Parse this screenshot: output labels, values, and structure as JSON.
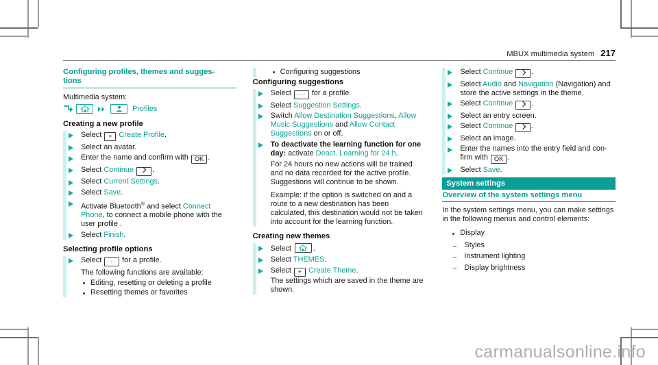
{
  "header": {
    "title": "MBUX multimedia system",
    "page_number": "217"
  },
  "colors": {
    "accent": "#0a9e96",
    "rail": "#c9f1f0",
    "text": "#1a1a1a",
    "band_text": "#ffffff"
  },
  "watermark": "carmanualsonline.info",
  "icons": {
    "arrow": "arrow-right-icon",
    "home": "home-icon",
    "profile": "profile-person-icon",
    "double_chevron": "double-chevron-right-icon",
    "plus_key": "plus-key-icon",
    "ok_key": "ok-key-icon",
    "dots_key": "ellipsis-key-icon",
    "chevron_key": "chevron-right-key-icon"
  },
  "column1": {
    "section_title": "Configuring profiles, themes and sugges-\ntions",
    "intro_label": "Multimedia system:",
    "path": {
      "home_label": "",
      "profiles_label": "Profiles"
    },
    "sub1": "Creating a new profile",
    "steps1": [
      {
        "pre": "Select",
        "key": "+",
        "link": "Create Profile",
        "post": "."
      },
      {
        "pre": "Select an avatar.",
        "key": "",
        "link": "",
        "post": ""
      },
      {
        "pre": "Enter the name and confirm with",
        "key": "OK",
        "link": "",
        "post": "."
      },
      {
        "pre": "Select",
        "key": ">",
        "link": "Continue",
        "post": "."
      },
      {
        "pre": "Select",
        "key": "",
        "link": "Current Settings",
        "post": "."
      },
      {
        "pre": "Select",
        "key": "",
        "link": "Save",
        "post": "."
      }
    ],
    "step_bluetooth": {
      "t1": "Activate Bluetooth",
      "sup": "®",
      "t2": " and select ",
      "link": "Connect Phone",
      "t3": ", to connect a mobile phone with the user profile ."
    },
    "step_finish": {
      "pre": "Select",
      "link": "Finish",
      "post": "."
    },
    "sub2": "Selecting profile options",
    "step_options": {
      "pre": "Select",
      "key": "···",
      "post": "for a profile."
    },
    "options_intro": "The following functions are available:",
    "options_list": [
      "Editing, resetting or deleting a profile",
      "Resetting themes or favorites"
    ]
  },
  "column2": {
    "top_bullet": "Configuring suggestions",
    "sub1": "Configuring suggestions",
    "steps": [
      {
        "pre": "Select",
        "key": "···",
        "post": "for a profile."
      },
      {
        "pre": "Select",
        "link": "Suggestion Settings",
        "post": "."
      }
    ],
    "switch_step": {
      "t1": "Switch ",
      "l1": "Allow Destination Suggestions",
      "t2": ", ",
      "l2": "Allow Music Suggestions",
      "t3": " and ",
      "l3": "Allow Contact Suggestions",
      "t4": " on or off."
    },
    "deactivate_step": {
      "bold": "To deactivate the learning function for one day:",
      "t1": " activate ",
      "link": "Deact. Learning for 24 h",
      "t2": "."
    },
    "deactivate_para": "For 24 hours no new actions will be trained and no data recorded for the active profile. Suggestions will continue to be shown.",
    "example_para": "Example: if the option is switched on and a route to a new destination has been calculated, this destination would not be taken into account for the learning function.",
    "sub2": "Creating new themes",
    "theme_steps": [
      {
        "pre": "Select",
        "key": "home",
        "post": "."
      },
      {
        "pre": "Select",
        "link": "THEMES",
        "post": "."
      },
      {
        "pre": "Select",
        "key": "+",
        "link": "Create Theme",
        "post": "."
      }
    ],
    "theme_note": "The settings which are saved in the theme are shown."
  },
  "column3": {
    "steps": [
      {
        "pre": "Select",
        "link": "Continue",
        "key": ">",
        "post": "."
      }
    ],
    "audio_nav_step": {
      "t1": "Select ",
      "l1": "Audio",
      "t2": " and ",
      "l2": "Navigation",
      "t3": " (Navigation) and store the active settings in the theme."
    },
    "steps_rest": [
      {
        "pre": "Select",
        "link": "Continue",
        "key": ">",
        "post": "."
      },
      {
        "pre": "Select an entry screen.",
        "link": "",
        "key": "",
        "post": ""
      },
      {
        "pre": "Select",
        "link": "Continue",
        "key": ">",
        "post": "."
      },
      {
        "pre": "Select an image.",
        "link": "",
        "key": "",
        "post": ""
      }
    ],
    "enter_names_step": {
      "t1": "Enter the names into the entry field and con-firm with ",
      "key": "OK",
      "t2": "."
    },
    "save_step": {
      "pre": "Select",
      "link": "Save",
      "post": "."
    },
    "sys_band": "System settings",
    "sys_sub": "Overview of the system settings menu",
    "sys_para": "In the system settings menu, you can make settings in the following menus and control elements:",
    "sys_bullet": "Display",
    "sys_dashes": [
      "Styles",
      "Instrument lighting",
      "Display brightness"
    ]
  }
}
